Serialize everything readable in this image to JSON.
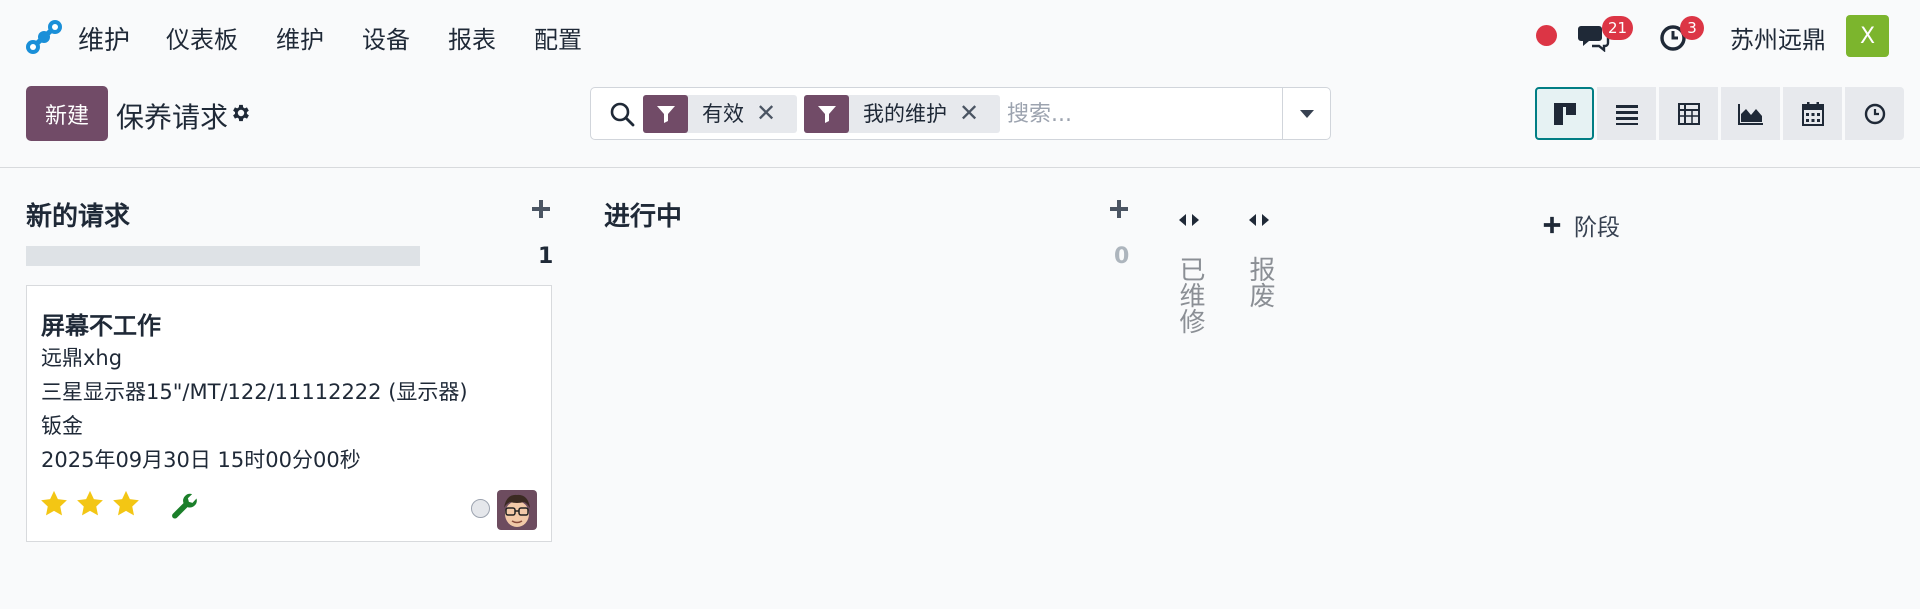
{
  "navbar": {
    "app_name": "维护",
    "menu": [
      {
        "label": "仪表板"
      },
      {
        "label": "维护"
      },
      {
        "label": "设备"
      },
      {
        "label": "报表"
      },
      {
        "label": "配置"
      }
    ],
    "messages_count": "21",
    "activities_count": "3",
    "company": "苏州远鼎",
    "user_initial": "X",
    "status_color": "#dc3545"
  },
  "control_panel": {
    "new_button": "新建",
    "title": "保养请求",
    "search": {
      "facets": [
        {
          "value": "有效"
        },
        {
          "value": "我的维护"
        }
      ],
      "placeholder": "搜索..."
    },
    "views": [
      "kanban-icon",
      "list-icon",
      "pivot-icon",
      "graph-icon",
      "calendar-icon",
      "activity-icon"
    ],
    "active_view": "kanban-icon"
  },
  "kanban": {
    "columns": [
      {
        "title": "新的请求",
        "count": "1"
      },
      {
        "title": "进行中",
        "count": "0"
      }
    ],
    "folded": [
      {
        "title": "已维修"
      },
      {
        "title": "报废"
      }
    ],
    "add_stage": "阶段",
    "cards": [
      {
        "title": "屏幕不工作",
        "lines": [
          "远鼎xhg",
          "三星显示器15\"/MT/122/11112222 (显示器)",
          "钣金",
          "2025年09月30日 15时00分00秒"
        ],
        "priority_stars": 3,
        "maintenance_icon": "wrench-icon"
      }
    ]
  },
  "colors": {
    "brand": "#714b67",
    "accent": "#017e84",
    "star": "#f3c614",
    "wrench": "#1b7f2a"
  }
}
